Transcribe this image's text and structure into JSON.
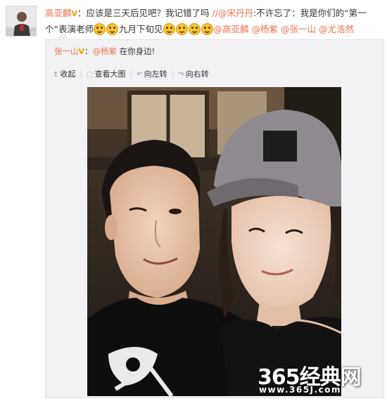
{
  "post": {
    "author": "高亚麟",
    "badge": "V",
    "text_1": "：应该是三天后见吧？我记错了吗 ",
    "repost_chain": "//",
    "mention_song": "@宋丹丹",
    "text_2": ":不许忘了：我是你们的“第一个”表演老师",
    "text_3": "九月下旬见",
    "mentions": [
      "@高亚麟",
      "@杨紫",
      "@张一山",
      "@尤浩然"
    ]
  },
  "repost": {
    "author": "张一山",
    "badge": "V",
    "colon": "：",
    "mention": "@杨紫",
    "text": " 在你身边!"
  },
  "toolbar": {
    "collapse": "收起",
    "view_large": "查看大图",
    "rotate_left": "向左转",
    "rotate_right": "向右转"
  },
  "icons": {
    "collapse": "collapse-arrow-icon",
    "view_large": "zoom-icon",
    "rotate_left": "rotate-left-icon",
    "rotate_right": "rotate-right-icon",
    "emoji": "laughing-emoji-icon",
    "verified": "verified-v-icon"
  },
  "watermark": {
    "brand": "365经典网",
    "url": "www.365J.com"
  },
  "colors": {
    "link": "#eb7350",
    "verified": "#f3a000",
    "repost_bg": "#f2f2f5"
  }
}
